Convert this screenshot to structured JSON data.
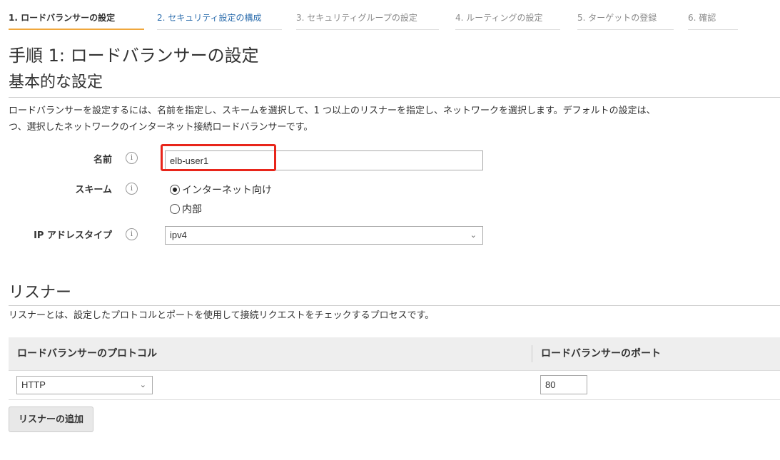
{
  "wizard": {
    "steps": [
      {
        "label": "1. ロードバランサーの設定"
      },
      {
        "label": "2. セキュリティ設定の構成"
      },
      {
        "label": "3. セキュリティグループの設定"
      },
      {
        "label": "4. ルーティングの設定"
      },
      {
        "label": "5. ターゲットの登録"
      },
      {
        "label": "6. 確認"
      }
    ]
  },
  "page": {
    "step_title": "手順 1: ロードバランサーの設定",
    "basic_section_title": "基本的な設定",
    "basic_description_line1": "ロードバランサーを設定するには、名前を指定し、スキームを選択して、1 つ以上のリスナーを指定し、ネットワークを選択します。デフォルトの設定は、",
    "basic_description_line2": "つ、選択したネットワークのインターネット接続ロードバランサーです。"
  },
  "form": {
    "name_label": "名前",
    "name_value": "elb-user1",
    "scheme_label": "スキーム",
    "scheme_options": [
      {
        "label": "インターネット向け",
        "selected": true
      },
      {
        "label": "内部",
        "selected": false
      }
    ],
    "ip_label": "IP アドレスタイプ",
    "ip_value": "ipv4",
    "info_glyph": "i"
  },
  "listeners": {
    "title": "リスナー",
    "description": "リスナーとは、設定したプロトコルとポートを使用して接続リクエストをチェックするプロセスです。",
    "col_protocol": "ロードバランサーのプロトコル",
    "col_port": "ロードバランサーのポート",
    "rows": [
      {
        "protocol": "HTTP",
        "port": "80"
      }
    ],
    "add_button": "リスナーの追加"
  },
  "colors": {
    "active_step_underline": "#f0a73c",
    "next_step_text": "#2c6dad",
    "highlight_box": "#e8251a"
  }
}
